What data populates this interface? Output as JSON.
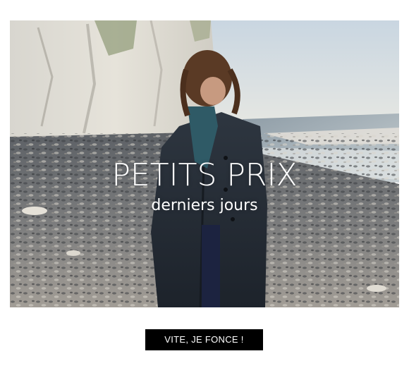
{
  "hero": {
    "headline": "PETITS PRIX",
    "subline": "derniers jours"
  },
  "cta": {
    "label": "VITE, JE FONCE !"
  },
  "colors": {
    "cta_background": "#000000",
    "cta_text": "#ffffff",
    "headline_text": "#ffffff"
  }
}
